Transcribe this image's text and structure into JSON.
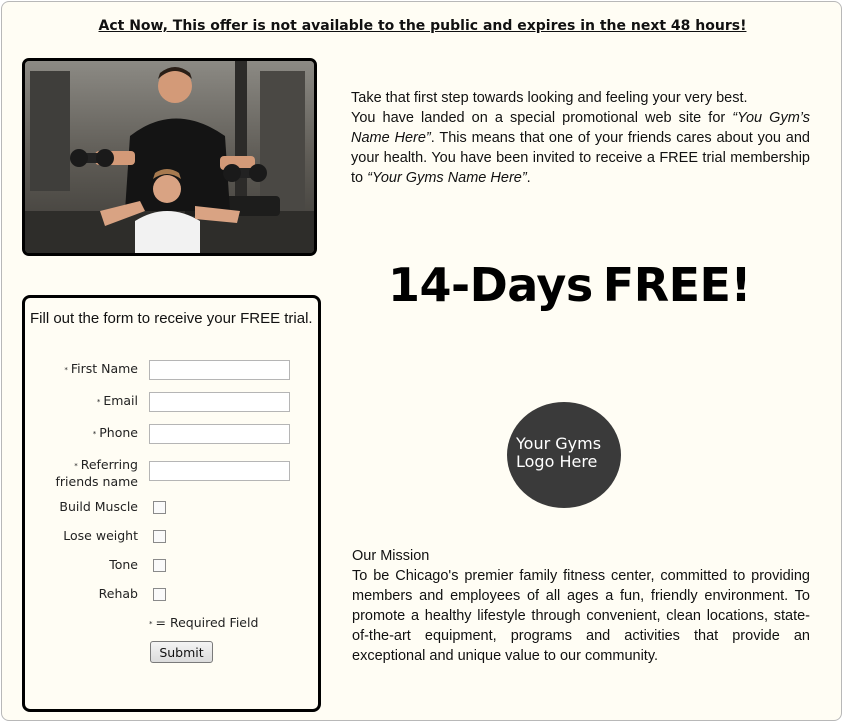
{
  "headline": "Act Now, This offer is not available to the public and expires in the next 48 hours!",
  "intro": {
    "line1": "Take that first step towards looking and feeling your very best.",
    "p_a": "You have landed on a special promotional web site for ",
    "gym_name_1": "“You Gym’s Name Here”",
    "p_b": ". This means that one of your friends cares about you and your health. You have been invited to receive a FREE trial membership to ",
    "gym_name_2": "“Your Gyms Name Here”",
    "p_c": "."
  },
  "offer": {
    "days": "14-Days",
    "free": "FREE!"
  },
  "logo": {
    "line1": "Your Gyms",
    "line2": "Logo Here"
  },
  "mission": {
    "title": "Our Mission",
    "text": "To be Chicago's premier family fitness center, committed to providing members and employees of all ages a fun, friendly environment. To promote a healthy lifestyle through convenient, clean locations, state-of-the-art equipment, programs and activities that provide an exceptional and unique value to our community."
  },
  "form": {
    "title": "Fill out the form to receive your FREE trial.",
    "required_marker": "*",
    "first_name_label": "First Name",
    "first_name_value": "",
    "email_label": "Email",
    "email_value": "",
    "phone_label": "Phone",
    "phone_value": "",
    "referring_label_1": "Referring",
    "referring_label_2": "friends name",
    "referring_value": "",
    "checkboxes": [
      "Build Muscle",
      "Lose weight",
      "Tone",
      "Rehab"
    ],
    "required_note": "= Required Field",
    "submit_label": "Submit"
  }
}
